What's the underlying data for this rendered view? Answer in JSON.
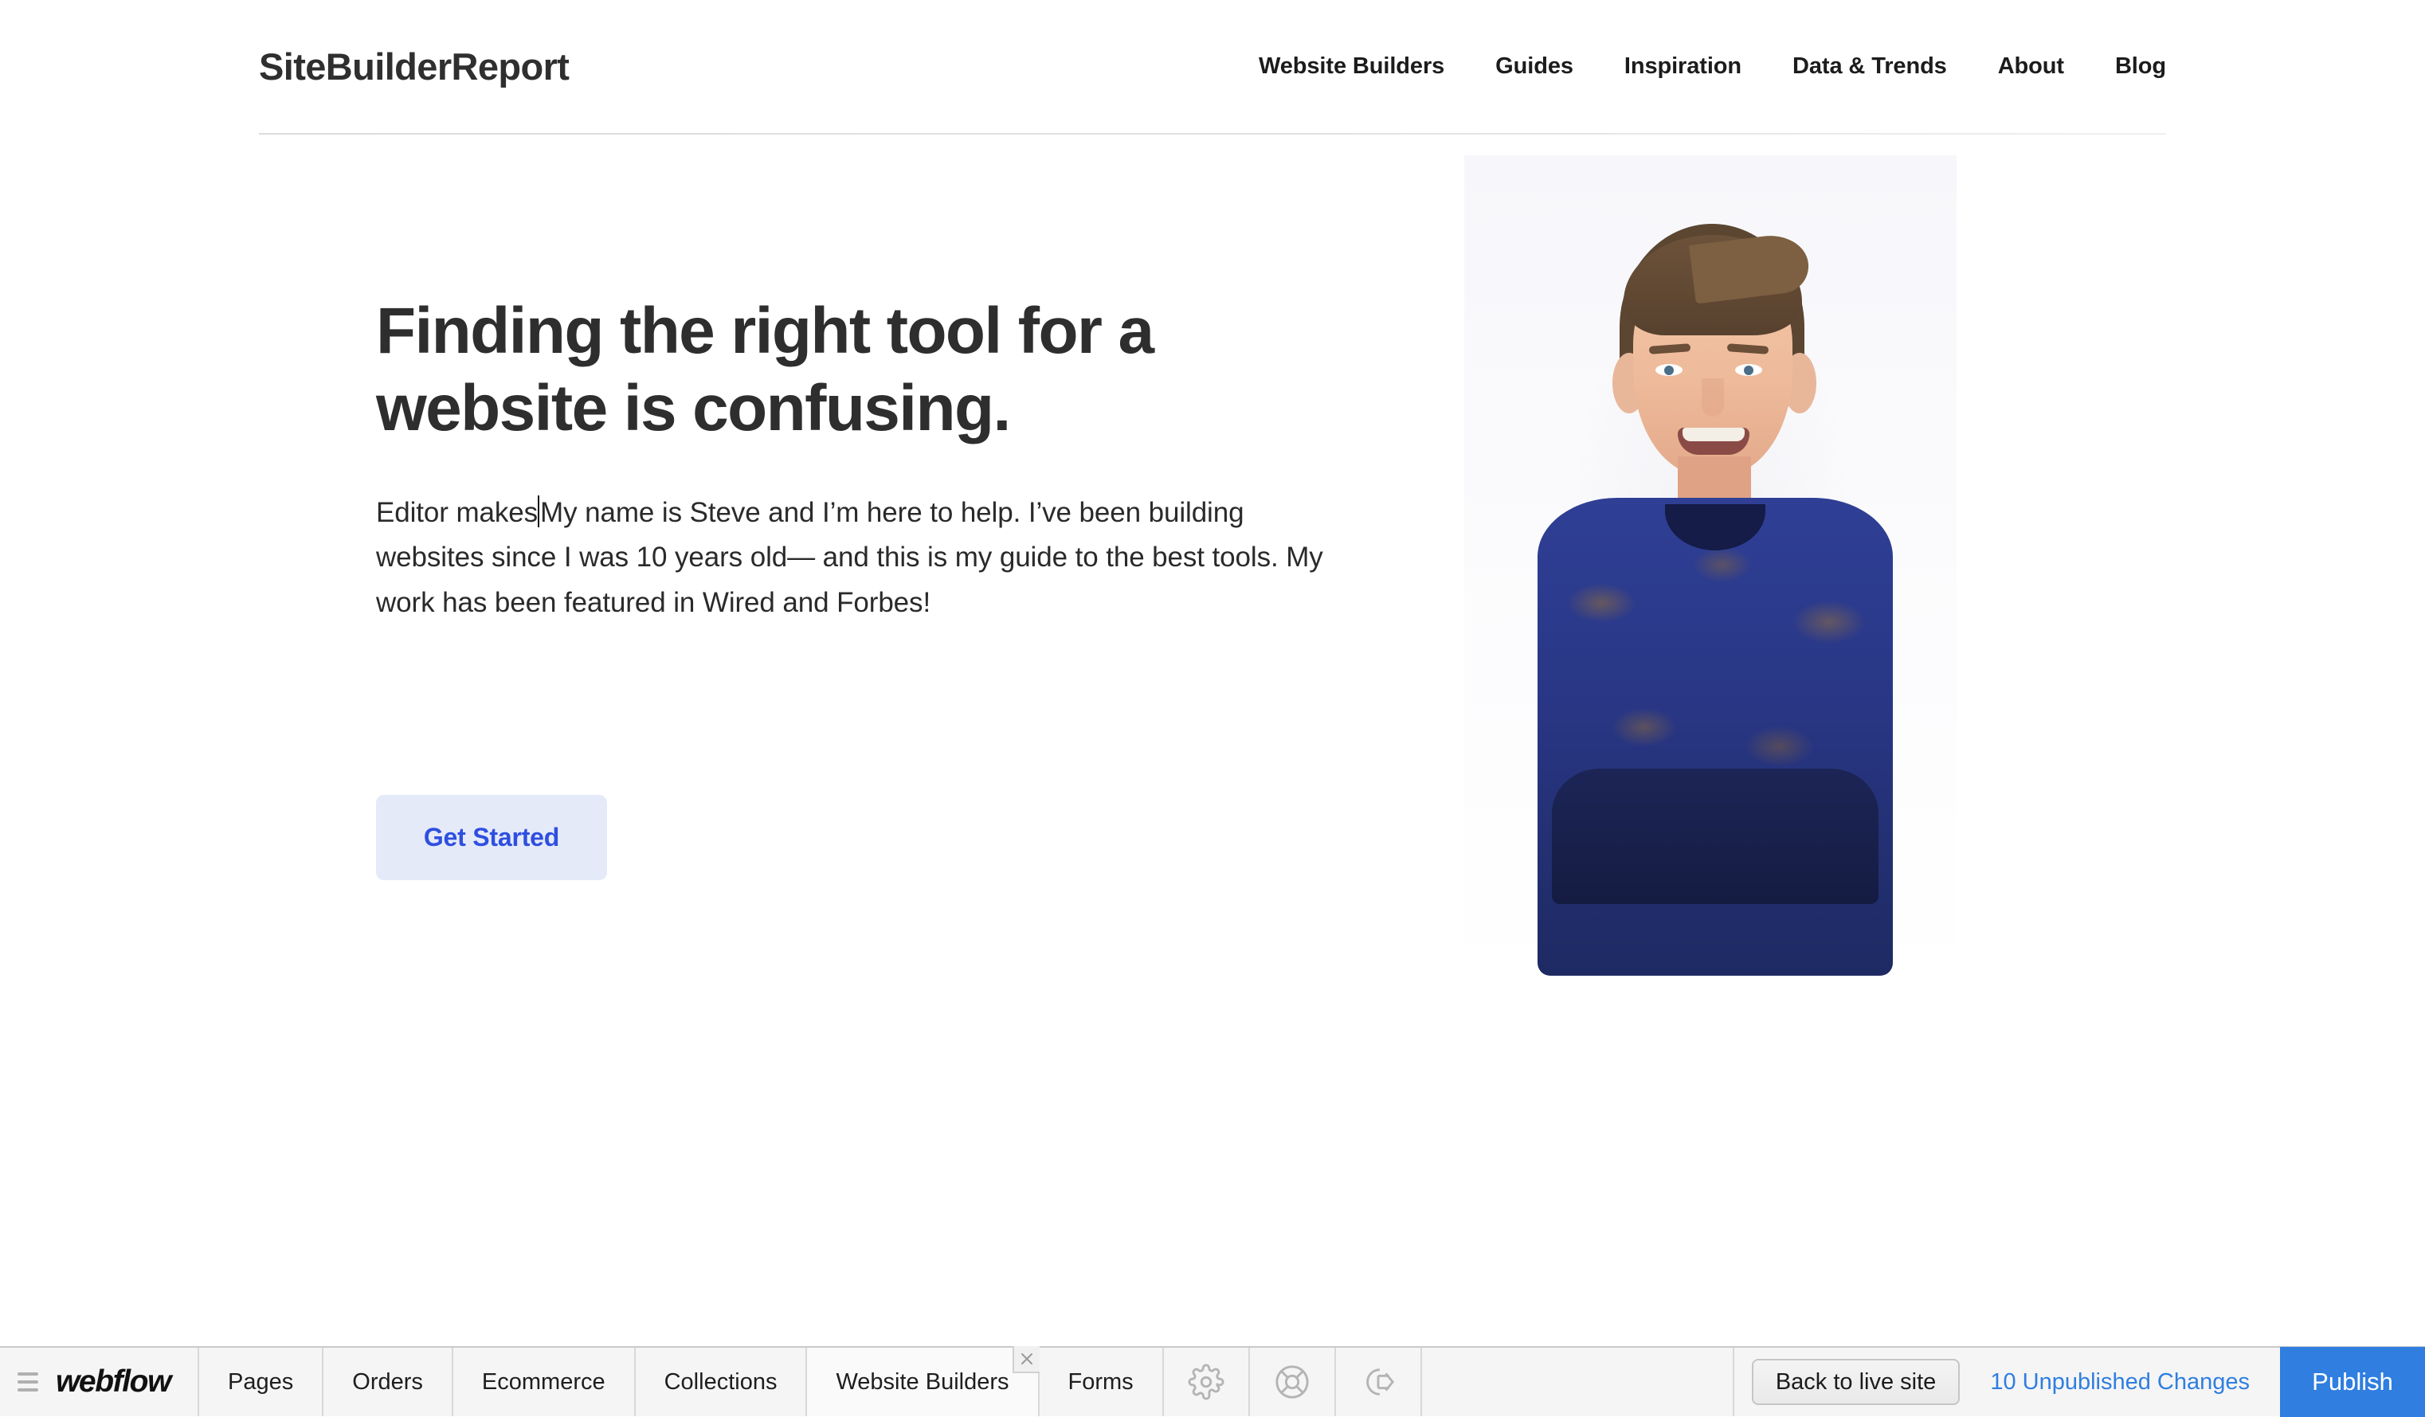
{
  "site": {
    "logo": "SiteBuilderReport",
    "nav": [
      {
        "label": "Website Builders"
      },
      {
        "label": "Guides"
      },
      {
        "label": "Inspiration"
      },
      {
        "label": "Data & Trends"
      },
      {
        "label": "About"
      },
      {
        "label": "Blog"
      }
    ]
  },
  "hero": {
    "heading": "Finding the right tool for a website is confusing.",
    "paragraph_before_caret": "Editor makes",
    "paragraph_after_caret": "My name is Steve and I’m here to help. I’ve been building websites since I was 10 years old— and this is my guide to the best tools. My work has been featured in Wired and Forbes!",
    "cta_label": "Get Started",
    "photo_alt": "Portrait of Steve smiling with arms crossed wearing a blue paisley sweater"
  },
  "editor": {
    "brand": "webflow",
    "menu_icon": "hamburger-icon",
    "tabs": [
      {
        "label": "Pages",
        "active": false,
        "closable": false
      },
      {
        "label": "Orders",
        "active": false,
        "closable": false
      },
      {
        "label": "Ecommerce",
        "active": false,
        "closable": false
      },
      {
        "label": "Collections",
        "active": false,
        "closable": false
      },
      {
        "label": "Website Builders",
        "active": true,
        "closable": true
      },
      {
        "label": "Forms",
        "active": false,
        "closable": false
      }
    ],
    "icon_buttons": [
      {
        "name": "gear-icon",
        "title": "Site settings"
      },
      {
        "name": "lifebuoy-icon",
        "title": "Help"
      },
      {
        "name": "logout-icon",
        "title": "Log out"
      }
    ],
    "back_to_live_site": "Back to live site",
    "unpublished_changes": "10 Unpublished Changes",
    "publish": "Publish"
  },
  "colors": {
    "accent_blue": "#2f7ee0",
    "cta_text": "#2e4fe0",
    "cta_background": "#e5eaf9",
    "heading": "#2e2e2e",
    "editor_bar_background": "#f5f5f5",
    "editor_bar_border": "#c9c9c9"
  }
}
